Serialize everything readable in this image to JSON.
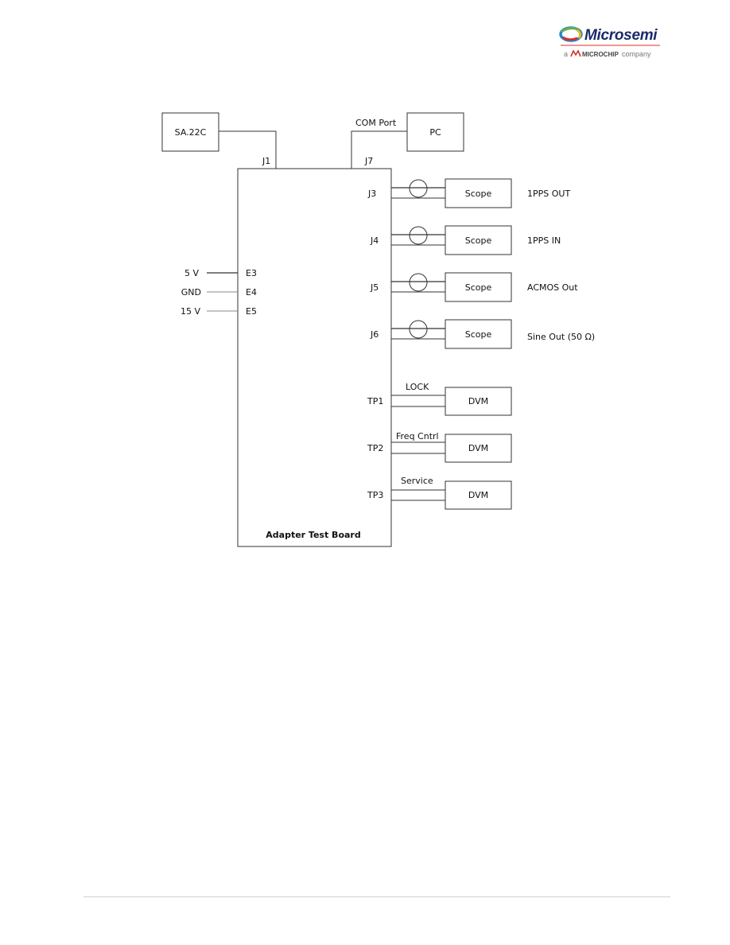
{
  "header": {
    "logo": {
      "icon": "microsemi-swirl-logo-icon",
      "name": "Microsemi",
      "tagline_prefix": "a",
      "tagline_brand": "Microchip",
      "tagline_suffix": "company",
      "brand_colors": {
        "text": "#1b2a6b",
        "blue": "#1e88c8",
        "green": "#6ab04c",
        "yellow": "#f2b517",
        "red": "#d9302a"
      }
    }
  },
  "diagram": {
    "board_label": "Adapter Test Board",
    "top_devices": [
      {
        "id": "sa22c",
        "label": "SA.22C",
        "connector": "J1",
        "wire_label": ""
      },
      {
        "id": "pc",
        "label": "PC",
        "connector": "J7",
        "wire_label": "COM Port"
      }
    ],
    "power_inputs": [
      {
        "source": "5 V",
        "terminal": "E3"
      },
      {
        "source": "GND",
        "terminal": "E4"
      },
      {
        "source": "15 V",
        "terminal": "E5"
      }
    ],
    "coax_outputs": [
      {
        "connector": "J3",
        "instrument": "Scope",
        "signal": "1PPS OUT"
      },
      {
        "connector": "J4",
        "instrument": "Scope",
        "signal": "1PPS IN"
      },
      {
        "connector": "J5",
        "instrument": "Scope",
        "signal": "ACMOS Out"
      },
      {
        "connector": "J6",
        "instrument": "Scope",
        "signal": "Sine Out (50 Ω)"
      }
    ],
    "test_points": [
      {
        "connector": "TP1",
        "instrument": "DVM",
        "signal": "LOCK"
      },
      {
        "connector": "TP2",
        "instrument": "DVM",
        "signal": "Freq Cntrl"
      },
      {
        "connector": "TP3",
        "instrument": "DVM",
        "signal": "Service"
      }
    ]
  }
}
